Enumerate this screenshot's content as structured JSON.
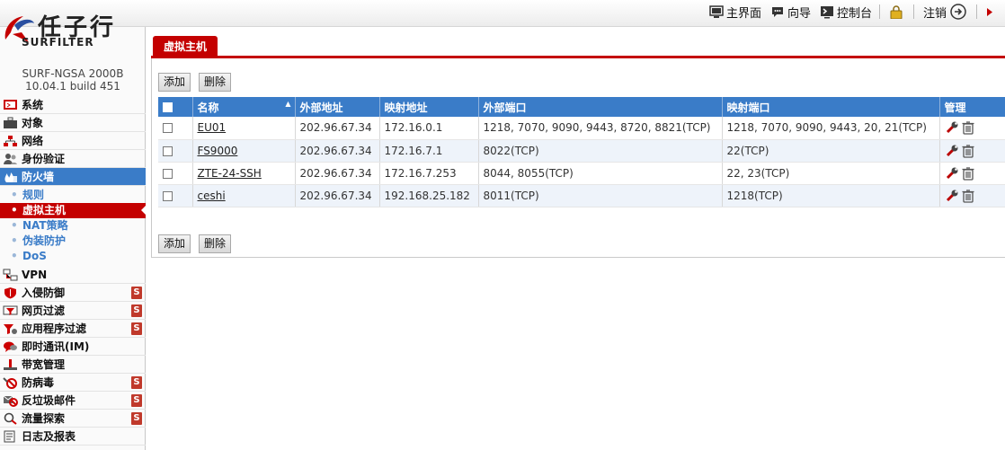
{
  "brand": {
    "name_cn": "任子行",
    "name_en": "SURFILTER",
    "model": "SURF-NGSA 2000B",
    "version": "10.04.1 build 451"
  },
  "topnav": {
    "home": "主界面",
    "wizard": "向导",
    "console": "控制台",
    "logout": "注销"
  },
  "sidebar": {
    "items": [
      {
        "label": "系统"
      },
      {
        "label": "对象"
      },
      {
        "label": "网络"
      },
      {
        "label": "身份验证"
      },
      {
        "label": "防火墙"
      }
    ],
    "firewall_sub": [
      {
        "label": "规则"
      },
      {
        "label": "虚拟主机"
      },
      {
        "label": "NAT策略"
      },
      {
        "label": "伪装防护"
      },
      {
        "label": "DoS"
      }
    ],
    "items_after": [
      {
        "label": "VPN"
      },
      {
        "label": "入侵防御",
        "badge": "S"
      },
      {
        "label": "网页过滤",
        "badge": "S"
      },
      {
        "label": "应用程序过滤",
        "badge": "S"
      },
      {
        "label": "即时通讯(IM)"
      },
      {
        "label": "带宽管理"
      },
      {
        "label": "防病毒",
        "badge": "S"
      },
      {
        "label": "反垃圾邮件",
        "badge": "S"
      },
      {
        "label": "流量探索",
        "badge": "S"
      },
      {
        "label": "日志及报表"
      }
    ]
  },
  "tab": {
    "label": "虚拟主机"
  },
  "buttons": {
    "add": "添加",
    "delete": "删除"
  },
  "table": {
    "headers": {
      "name": "名称",
      "ext_addr": "外部地址",
      "map_addr": "映射地址",
      "ext_port": "外部端口",
      "map_port": "映射端口",
      "manage": "管理"
    },
    "rows": [
      {
        "name": "EU01",
        "ext_addr": "202.96.67.34",
        "map_addr": "172.16.0.1",
        "ext_port": "1218, 7070, 9090, 9443, 8720, 8821(TCP)",
        "map_port": "1218, 7070, 9090, 9443, 20, 21(TCP)"
      },
      {
        "name": "FS9000",
        "ext_addr": "202.96.67.34",
        "map_addr": "172.16.7.1",
        "ext_port": "8022(TCP)",
        "map_port": "22(TCP)"
      },
      {
        "name": "ZTE-24-SSH",
        "ext_addr": "202.96.67.34",
        "map_addr": "172.16.7.253",
        "ext_port": "8044, 8055(TCP)",
        "map_port": "22, 23(TCP)"
      },
      {
        "name": "ceshi",
        "ext_addr": "202.96.67.34",
        "map_addr": "192.168.25.182",
        "ext_port": "8011(TCP)",
        "map_port": "1218(TCP)"
      }
    ]
  },
  "colors": {
    "accent_red": "#c40000",
    "accent_blue": "#3a7cc8"
  }
}
